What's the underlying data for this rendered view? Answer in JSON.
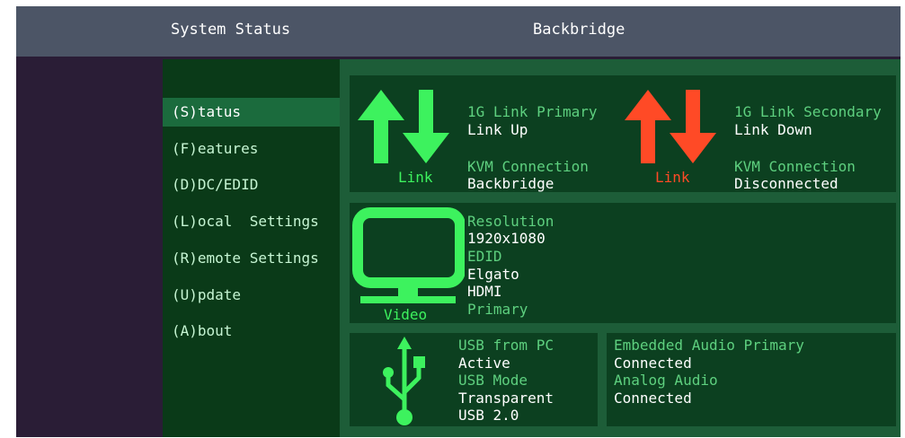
{
  "header": {
    "left_title": "System Status",
    "right_title": "Backbridge"
  },
  "menu": {
    "items": [
      {
        "label": "(S)tatus",
        "active": true
      },
      {
        "label": "(F)eatures",
        "active": false
      },
      {
        "label": "(D)DC/EDID",
        "active": false
      },
      {
        "label": "(L)ocal  Settings",
        "active": false
      },
      {
        "label": "(R)emote Settings",
        "active": false
      },
      {
        "label": "(U)pdate",
        "active": false
      },
      {
        "label": "(A)bout",
        "active": false
      }
    ]
  },
  "link_primary": {
    "icon": "link-up-down-arrows-icon",
    "color": "#3df25e",
    "caption": "Link",
    "link_label": "1G Link Primary",
    "link_value": "Link Up",
    "kvm_label": "KVM Connection",
    "kvm_value": "Backbridge"
  },
  "link_secondary": {
    "icon": "link-up-down-arrows-icon",
    "color": "#ff4a26",
    "caption": "Link",
    "link_label": "1G Link Secondary",
    "link_value": "Link Down",
    "kvm_label": "KVM Connection",
    "kvm_value": "Disconnected"
  },
  "video": {
    "icon": "monitor-icon",
    "caption": "Video",
    "resolution_label": "Resolution",
    "resolution_value": "1920x1080",
    "edid_label": "EDID",
    "edid_value1": "Elgato",
    "edid_value2": "HDMI",
    "edid_value3": "Primary"
  },
  "usb": {
    "icon": "usb-icon",
    "from_pc_label": "USB from PC",
    "from_pc_value": "Active",
    "mode_label": "USB Mode",
    "mode_value": "Transparent",
    "version_value": "USB 2.0"
  },
  "audio": {
    "embedded_label": "Embedded Audio Primary",
    "embedded_value": "Connected",
    "analog_label": "Analog Audio",
    "analog_value": "Connected"
  }
}
